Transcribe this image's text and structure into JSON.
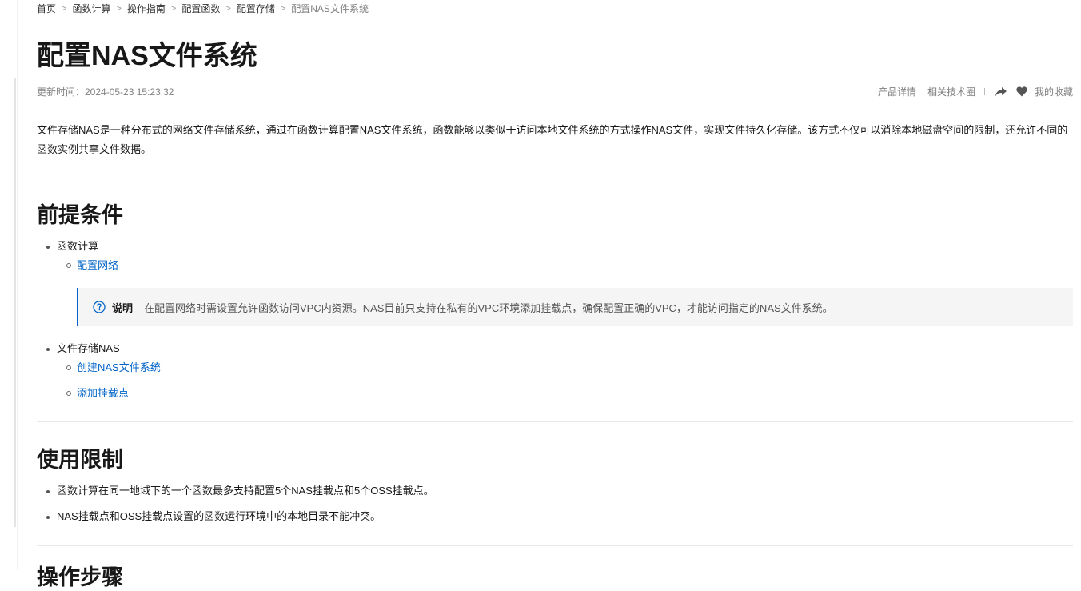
{
  "breadcrumb": {
    "items": [
      "首页",
      "函数计算",
      "操作指南",
      "配置函数",
      "配置存储"
    ],
    "current": "配置NAS文件系统"
  },
  "title": "配置NAS文件系统",
  "meta": {
    "updated": "更新时间：2024-05-23 15:23:32",
    "product_details": "产品详情",
    "tech_circle": "相关技术圈",
    "favorites": "我的收藏",
    "share_icon": "share-icon",
    "favorite_icon": "heart-icon"
  },
  "intro": "文件存储NAS是一种分布式的网络文件存储系统，通过在函数计算配置NAS文件系统，函数能够以类似于访问本地文件系统的方式操作NAS文件，实现文件持久化存储。该方式不仅可以消除本地磁盘空间的限制，还允许不同的函数实例共享文件数据。",
  "prereq": {
    "heading": "前提条件",
    "items": [
      {
        "label": "函数计算",
        "links": [
          "配置网络"
        ]
      },
      {
        "label": "文件存储NAS",
        "links": [
          "创建NAS文件系统",
          "添加挂载点"
        ]
      }
    ],
    "note": {
      "label": "说明",
      "text": "在配置网络时需设置允许函数访问VPC内资源。NAS目前只支持在私有的VPC环境添加挂载点，确保配置正确的VPC，才能访问指定的NAS文件系统。",
      "icon": "help-circle-icon"
    }
  },
  "limits": {
    "heading": "使用限制",
    "items": [
      "函数计算在同一地域下的一个函数最多支持配置5个NAS挂载点和5个OSS挂载点。",
      "NAS挂载点和OSS挂载点设置的函数运行环境中的本地目录不能冲突。"
    ]
  },
  "next_heading": "操作步骤",
  "colors": {
    "link": "#0064c8",
    "note_border": "#0064c8",
    "note_bg": "#f5f5f5"
  }
}
